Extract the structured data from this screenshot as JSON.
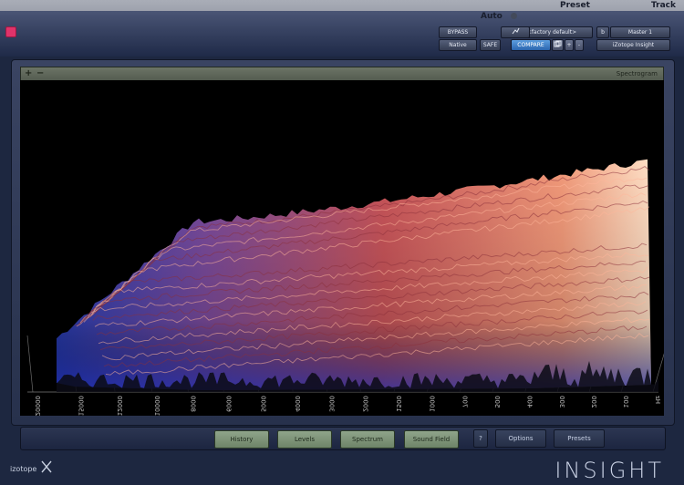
{
  "host": {
    "labels": {
      "track": "Track",
      "preset": "Preset",
      "auto": "Auto"
    },
    "track_name": "Master 1",
    "track_slot": "b",
    "plugin_name": "iZotope Insight",
    "preset_name": "<factory default>",
    "preset_minus": "-",
    "preset_plus": "+",
    "compare_label": "COMPARE",
    "safe_label": "SAFE",
    "bypass_label": "BYPASS",
    "native_label": "Native",
    "plugin_icon": "plugin-insert-icon",
    "accent_color": "#e0336a"
  },
  "panel": {
    "title": "Spectrogram",
    "collapse_button": "−",
    "expand_button": "+"
  },
  "chart_data": {
    "type": "3d-spectrogram",
    "frequency_ticks": [
      "20000",
      "15000",
      "12000",
      "10000",
      "8000",
      "6000",
      "5000",
      "4000",
      "3000",
      "2000",
      "1500",
      "1000",
      "700",
      "500",
      "400",
      "300",
      "200",
      "100",
      "Hz"
    ],
    "series_colors": {
      "low": "#3b3fb5",
      "mid": "#c24e55",
      "high": "#ffd2b8"
    }
  },
  "tabs": {
    "options_label": "Options",
    "presets_label": "Presets",
    "help_label": "?",
    "items": [
      {
        "label": "Sound Field"
      },
      {
        "label": "Spectrum"
      },
      {
        "label": "Levels"
      },
      {
        "label": "History"
      }
    ]
  },
  "brand": {
    "left_word": "izotope",
    "logo_icon": "izotope-logo-icon",
    "product_name": "INSIGHT"
  }
}
